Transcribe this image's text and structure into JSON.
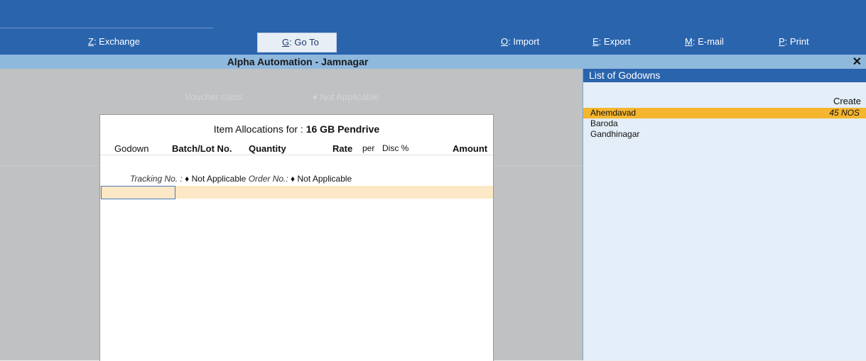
{
  "toolbar": {
    "exchange": {
      "key": "Z",
      "label": ": Exchange"
    },
    "goto": {
      "key": "G",
      "label": ": Go To"
    },
    "import": {
      "key": "O",
      "label": ": Import"
    },
    "export": {
      "key": "E",
      "label": ": Export"
    },
    "email": {
      "key": "M",
      "label": ": E-mail"
    },
    "print": {
      "key": "P",
      "label": ": Print"
    }
  },
  "titlebar": {
    "title": "Alpha Automation - Jamnagar",
    "close": "✕"
  },
  "background": {
    "colon": ":",
    "voucher_class_label": "Voucher class",
    "voucher_class_value": "♦ Not Applicable"
  },
  "dialog": {
    "title_prefix": "Item Allocations for :",
    "item_name": "16 GB Pendrive",
    "columns": {
      "godown": "Godown",
      "batch": "Batch/Lot No.",
      "quantity": "Quantity",
      "rate": "Rate",
      "per": "per",
      "disc": "Disc %",
      "amount": "Amount"
    },
    "tracking_label": "Tracking No. :",
    "tracking_value": "♦ Not Applicable",
    "order_label": "Order No.:",
    "order_value": "♦ Not Applicable"
  },
  "panel": {
    "title": "List of Godowns",
    "create": "Create",
    "items": [
      {
        "name": "Ahemdavad",
        "qty": "45 NOS"
      },
      {
        "name": "Baroda",
        "qty": ""
      },
      {
        "name": "Gandhinagar",
        "qty": ""
      }
    ]
  }
}
